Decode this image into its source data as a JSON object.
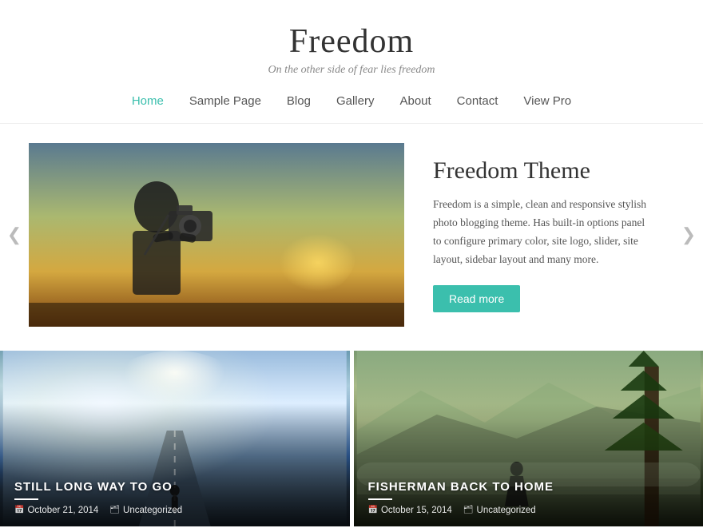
{
  "site": {
    "title": "Freedom",
    "tagline": "On the other side of fear lies freedom"
  },
  "nav": {
    "items": [
      {
        "label": "Home",
        "active": true
      },
      {
        "label": "Sample Page",
        "active": false
      },
      {
        "label": "Blog",
        "active": false
      },
      {
        "label": "Gallery",
        "active": false
      },
      {
        "label": "About",
        "active": false
      },
      {
        "label": "Contact",
        "active": false
      },
      {
        "label": "View Pro",
        "active": false
      }
    ]
  },
  "slider": {
    "title": "Freedom Theme",
    "description": "Freedom is a simple, clean and responsive stylish photo blogging theme. Has built-in options panel to configure primary color, site logo, slider, site layout, sidebar layout and many more.",
    "read_more_label": "Read more",
    "arrow_left": "❮",
    "arrow_right": "❯"
  },
  "cards": [
    {
      "title": "STILL LONG WAY TO GO",
      "date": "October 21, 2014",
      "category": "Uncategorized"
    },
    {
      "title": "FISHERMAN BACK TO HOME",
      "date": "October 15, 2014",
      "category": "Uncategorized"
    }
  ]
}
